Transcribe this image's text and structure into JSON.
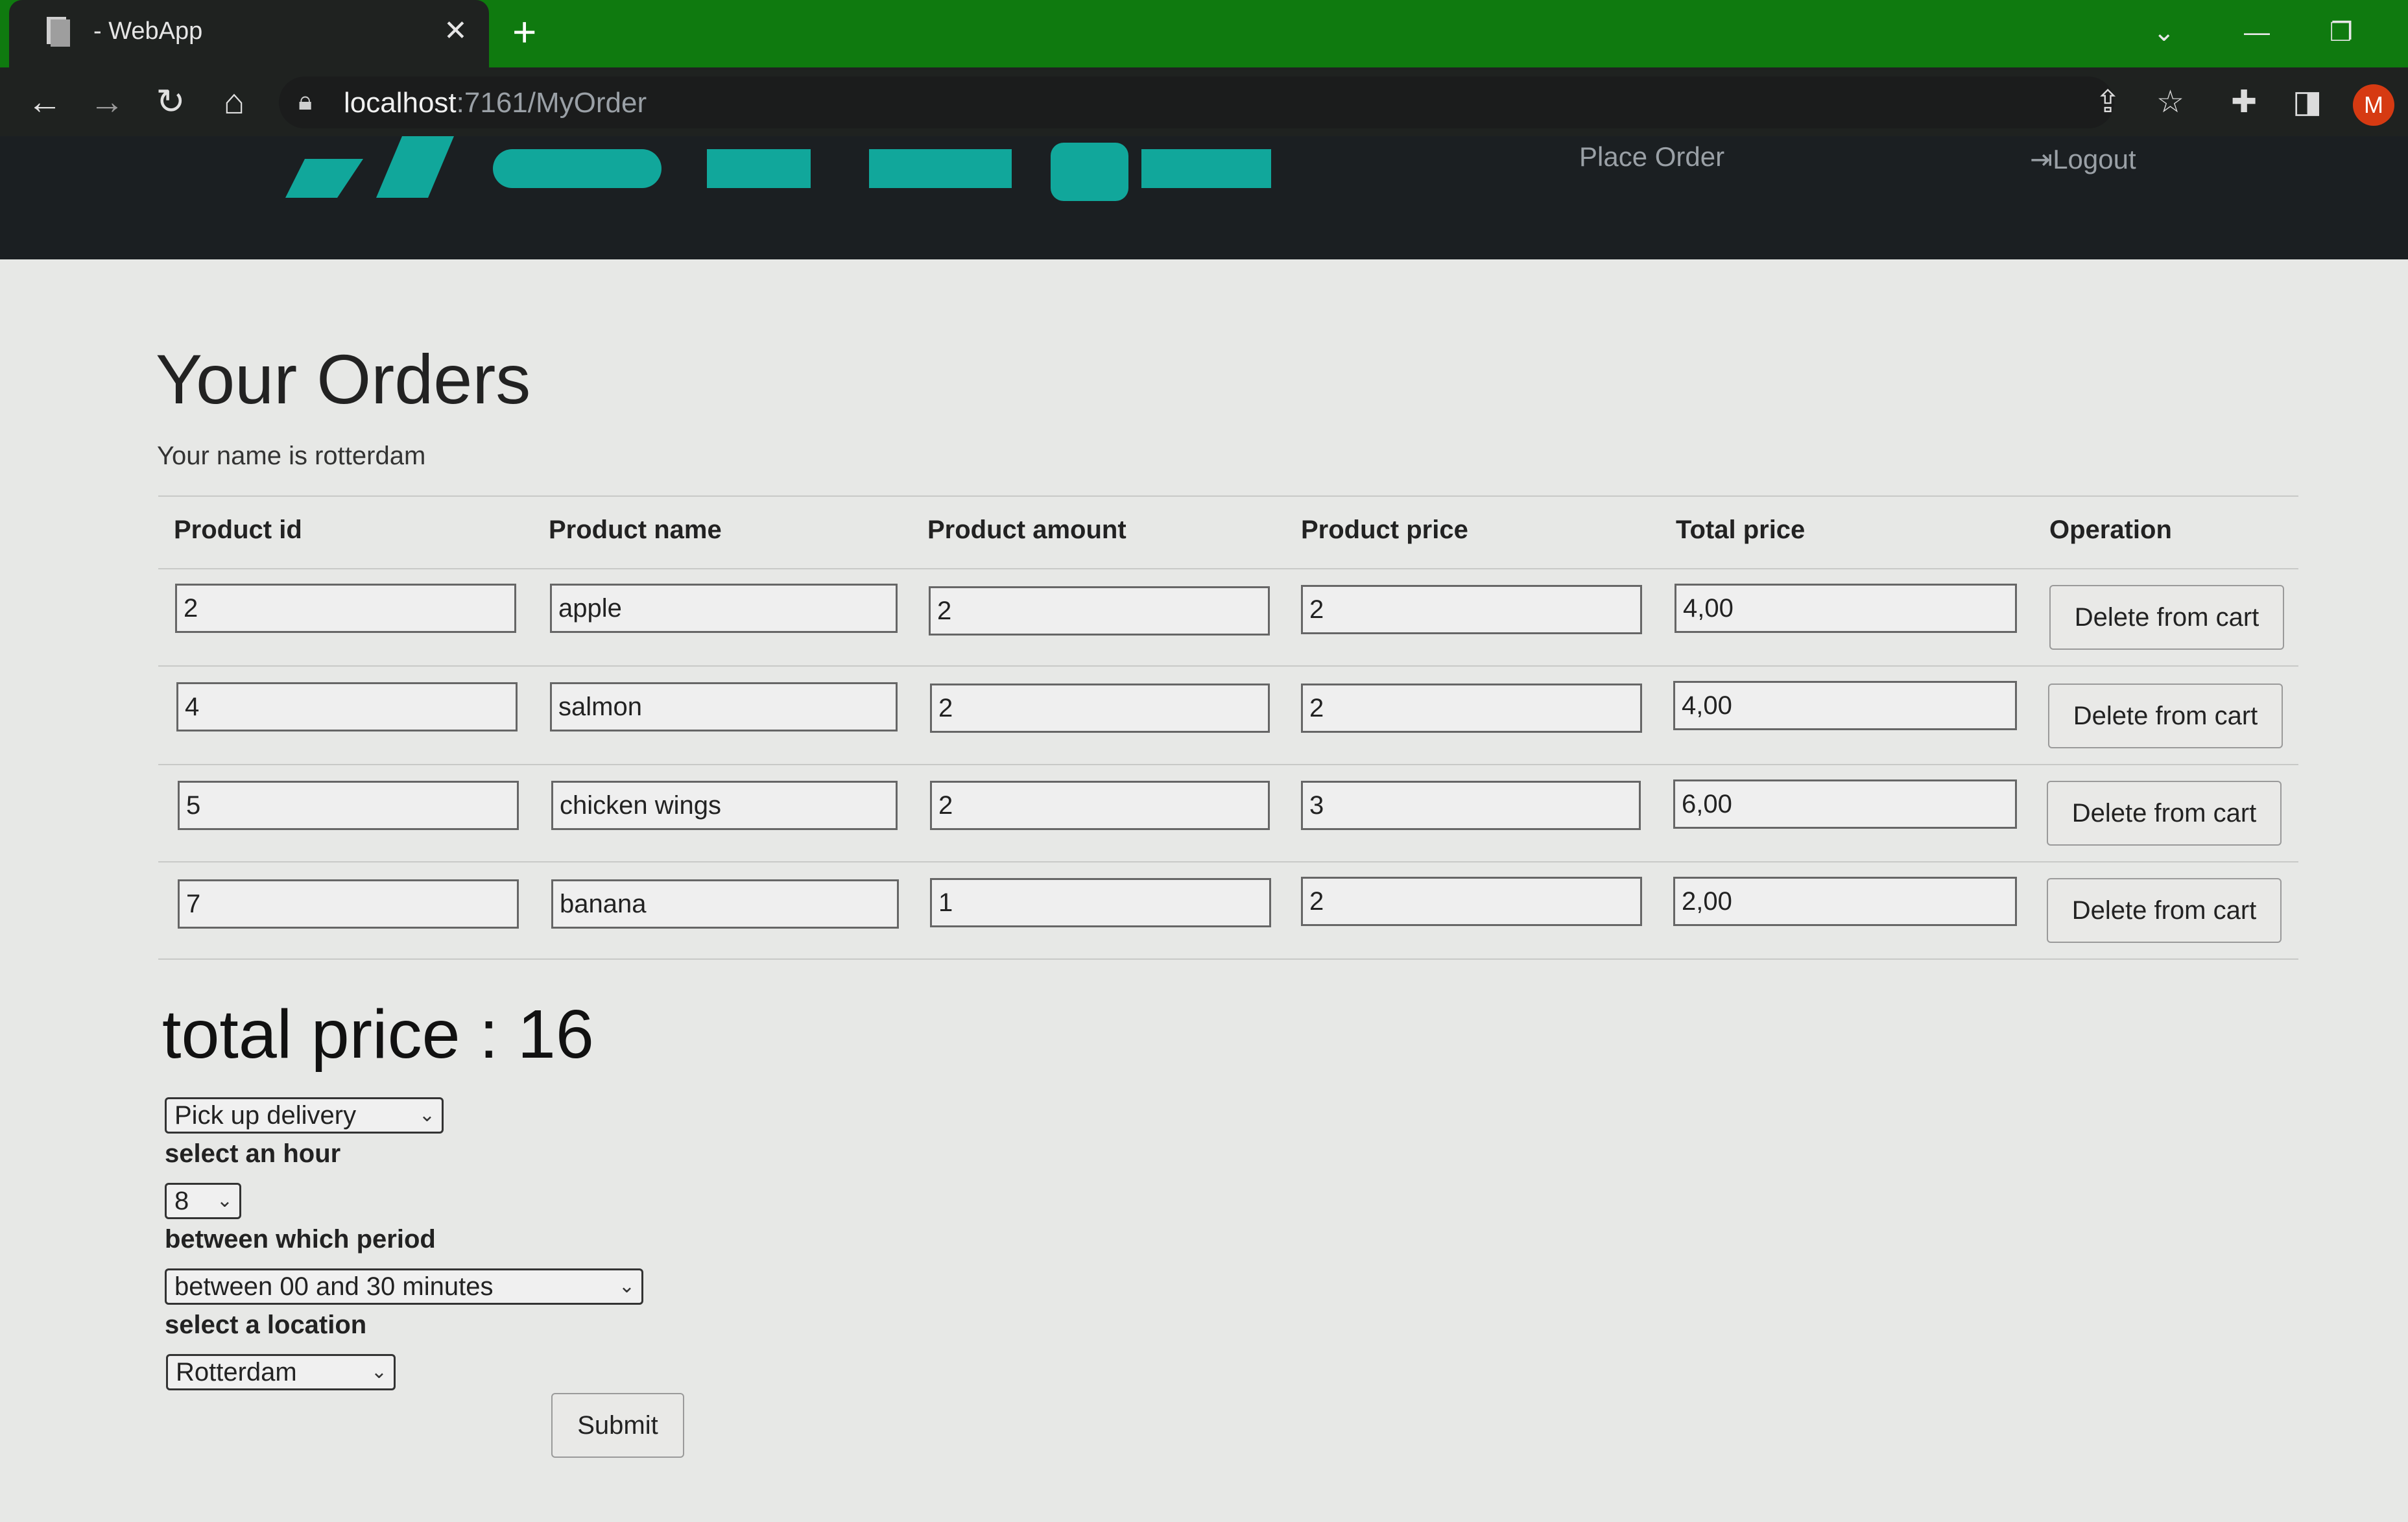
{
  "browser": {
    "tab_title": "- WebApp",
    "url_host": "localhost",
    "url_rest": ":7161/MyOrder",
    "profile_initial": "M"
  },
  "navbar": {
    "place_order": "Place Order",
    "logout": "Logout"
  },
  "page": {
    "title": "Your Orders",
    "username_text": "Your name is rotterdam"
  },
  "table": {
    "headers": [
      "Product id",
      "Product name",
      "Product amount",
      "Product price",
      "Total price",
      "Operation"
    ],
    "rows": [
      {
        "id": "2",
        "name": "apple",
        "amount": "2",
        "price": "2",
        "total": "4,00",
        "action": "Delete from cart"
      },
      {
        "id": "4",
        "name": "salmon",
        "amount": "2",
        "price": "2",
        "total": "4,00",
        "action": "Delete from cart"
      },
      {
        "id": "5",
        "name": "chicken wings",
        "amount": "2",
        "price": "3",
        "total": "6,00",
        "action": "Delete from cart"
      },
      {
        "id": "7",
        "name": "banana",
        "amount": "1",
        "price": "2",
        "total": "2,00",
        "action": "Delete from cart"
      }
    ]
  },
  "order_form": {
    "total_text": "total price : 16",
    "delivery_select": "Pick up delivery",
    "hour_label": "select an hour",
    "hour_select": "8",
    "period_label": "between which period",
    "period_select": "between 00 and 30 minutes",
    "location_label": "select a location",
    "location_select": "Rotterdam",
    "submit_label": "Submit"
  },
  "colors": {
    "tabbar": "#0f7a0f",
    "brand": "#11a79b",
    "navbar": "#1b1f22",
    "page_bg": "#e7e8e6"
  }
}
